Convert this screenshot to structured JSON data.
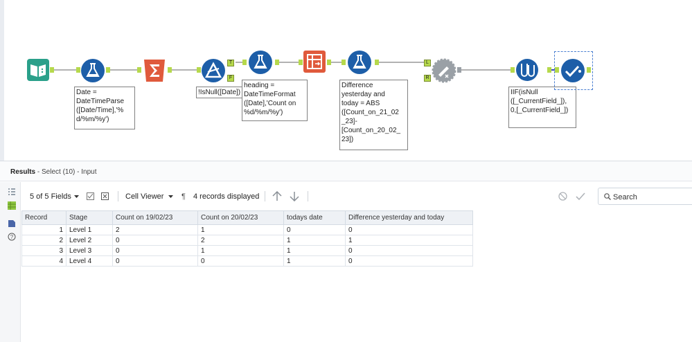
{
  "workflow": {
    "annotations": {
      "date_parse": "Date =\nDateTimeParse\n([Date/Time],'%\nd/%m/%y')",
      "filter": "!IsNull([Date])",
      "heading": "heading =\nDateTimeFormat\n([Date],'Count on\n%d/%m/%y')",
      "difference": "Difference\nyesterday and\ntoday = ABS\n([Count_on_21_02\n_23]-\n[Count_on_20_02_\n23])",
      "multifield": "IIF(isNull\n([_CurrentField_]),\n0,[_CurrentField_])"
    },
    "anchors": {
      "true": "T",
      "false": "F",
      "left": "L",
      "right": "R"
    },
    "colors": {
      "blue": "#1d5ea8",
      "orange": "#e05a3c",
      "green": "#2aa08a",
      "grey": "#9aa0a6",
      "connector": "#b6d94c"
    }
  },
  "results": {
    "title": "Results",
    "subtitle": " - Select (10) - Input"
  },
  "toolbar": {
    "fields": "5 of 5 Fields",
    "cell_viewer": "Cell Viewer",
    "pilcrow": "¶",
    "records": "4 records displayed",
    "search_placeholder": "Search"
  },
  "table": {
    "headers": [
      "Record",
      "Stage",
      "Count on 19/02/23",
      "Count on 20/02/23",
      "todays date",
      "Difference yesterday and today"
    ],
    "rows": [
      [
        "1",
        "Level 1",
        "2",
        "1",
        "0",
        "0"
      ],
      [
        "2",
        "Level 2",
        "0",
        "2",
        "1",
        "1"
      ],
      [
        "3",
        "Level 3",
        "0",
        "1",
        "1",
        "0"
      ],
      [
        "4",
        "Level 4",
        "0",
        "0",
        "1",
        "0"
      ]
    ]
  }
}
